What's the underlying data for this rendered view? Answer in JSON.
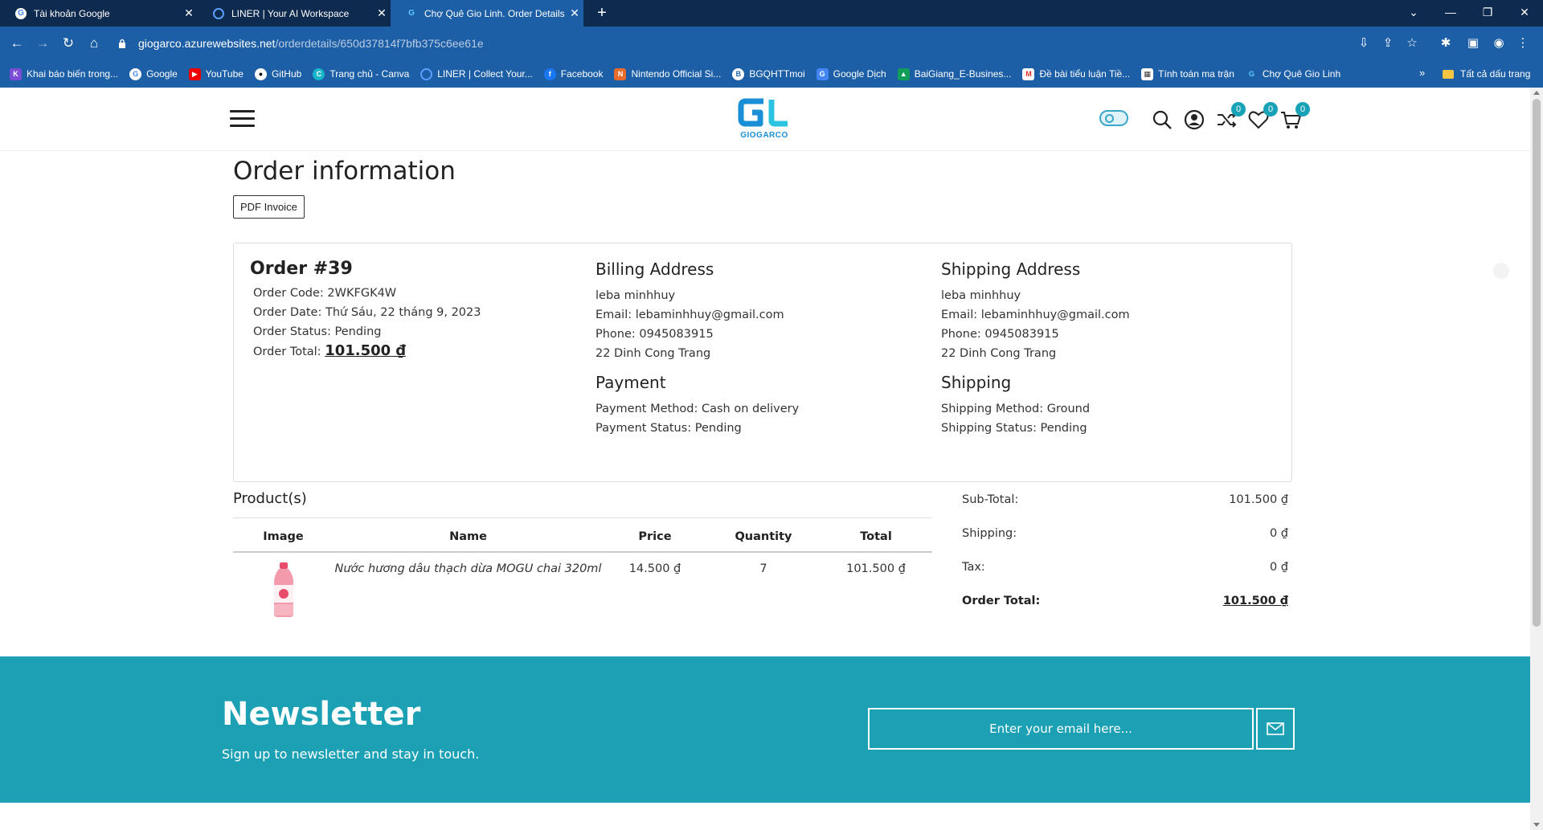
{
  "browser": {
    "tabs": [
      {
        "title": "Tài khoản Google",
        "active": false
      },
      {
        "title": "LINER | Your AI Workspace",
        "active": false
      },
      {
        "title": "Chợ Quê Gio Linh. Order Details",
        "active": true
      }
    ],
    "url_host": "giogarco.azurewebsites.net",
    "url_path": "/orderdetails/650d37814f7bfb375c6ee61e",
    "bookmarks": [
      "Khai báo biến trong...",
      "Google",
      "YouTube",
      "GitHub",
      "Trang chủ - Canva",
      "LINER | Collect Your...",
      "Facebook",
      "Nintendo Official Si...",
      "BGQHTTmoi",
      "Google Dịch",
      "BaiGiang_E-Busines...",
      "Đề bài tiểu luận Tiề...",
      "Tính toán ma trận",
      "Chợ Quê Gio Linh"
    ],
    "bookmarks_more": "»",
    "all_bookmarks": "Tất cả dấu trang"
  },
  "header": {
    "logo_text": "GIOGARCO",
    "compare_count": "0",
    "wishlist_count": "0",
    "cart_count": "0"
  },
  "page": {
    "title": "Order information",
    "pdf_button": "PDF Invoice"
  },
  "order": {
    "heading": "Order #39",
    "code": "Order Code: 2WKFGK4W",
    "date": "Order Date: Thứ Sáu, 22 tháng 9, 2023",
    "status": "Order Status: Pending",
    "total_label": "Order Total:",
    "total_value": "101.500 ₫"
  },
  "billing": {
    "heading": "Billing Address",
    "name": "leba minhhuy",
    "email": "Email: lebaminhhuy@gmail.com",
    "phone": "Phone: 0945083915",
    "address": "22 Dinh Cong Trang"
  },
  "shipping_address": {
    "heading": "Shipping Address",
    "name": "leba minhhuy",
    "email": "Email: lebaminhhuy@gmail.com",
    "phone": "Phone: 0945083915",
    "address": "22 Dinh Cong Trang"
  },
  "payment": {
    "heading": "Payment",
    "method": "Payment Method: Cash on delivery",
    "status": "Payment Status: Pending"
  },
  "shipping": {
    "heading": "Shipping",
    "method": "Shipping Method: Ground",
    "status": "Shipping Status: Pending"
  },
  "products": {
    "heading": "Product(s)",
    "columns": [
      "Image",
      "Name",
      "Price",
      "Quantity",
      "Total"
    ],
    "rows": [
      {
        "name": "Nước hương dâu thạch dừa MOGU chai 320ml",
        "price": "14.500 ₫",
        "quantity": "7",
        "total": "101.500 ₫"
      }
    ]
  },
  "summary": {
    "subtotal_label": "Sub-Total:",
    "subtotal_value": "101.500 ₫",
    "shipping_label": "Shipping:",
    "shipping_value": "0 ₫",
    "tax_label": "Tax:",
    "tax_value": "0 ₫",
    "total_label": "Order Total:",
    "total_value": "101.500 ₫"
  },
  "newsletter": {
    "title": "Newsletter",
    "subtitle": "Sign up to newsletter and stay in touch.",
    "placeholder": "Enter your email here..."
  },
  "colors": {
    "accent": "#1ba0b4",
    "chrome_dark": "#0f2a4f",
    "chrome": "#1d5fa6",
    "product_link": "#2c5f66"
  }
}
